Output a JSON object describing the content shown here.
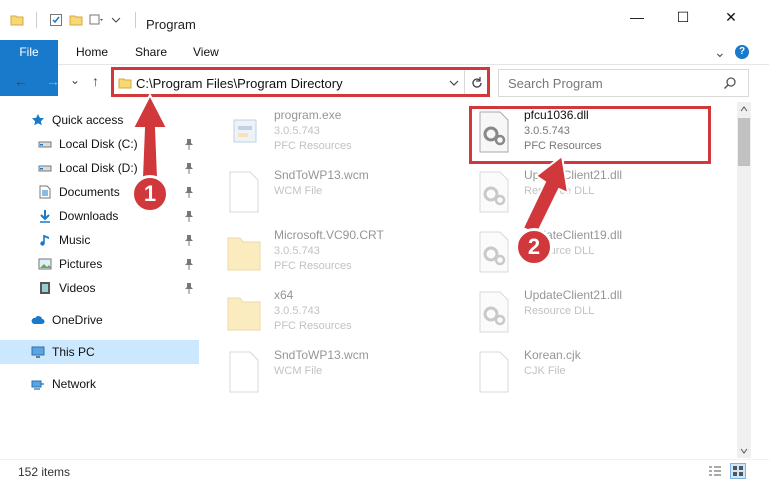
{
  "window": {
    "title": "Program",
    "controls": {
      "minimize": "—",
      "maximize": "☐",
      "close": "✕"
    }
  },
  "ribbon": {
    "tabs": [
      "File",
      "Home",
      "Share",
      "View"
    ],
    "expand_glyph": "⌄",
    "help_glyph": "?"
  },
  "nav": {
    "back": "←",
    "forward": "→",
    "dropdown": "⌄",
    "up": "↑",
    "address": "C:\\Program Files\\Program Directory",
    "search_placeholder": "Search Program"
  },
  "sidebar": {
    "items": [
      {
        "label": "Quick access",
        "icon": "star-icon",
        "pinned": false
      },
      {
        "label": "Local Disk (C:)",
        "icon": "drive-icon",
        "pinned": true
      },
      {
        "label": "Local Disk (D:)",
        "icon": "drive-icon",
        "pinned": true
      },
      {
        "label": "Documents",
        "icon": "documents-icon",
        "pinned": true
      },
      {
        "label": "Downloads",
        "icon": "download-icon",
        "pinned": true
      },
      {
        "label": "Music",
        "icon": "music-icon",
        "pinned": true
      },
      {
        "label": "Pictures",
        "icon": "pictures-icon",
        "pinned": true
      },
      {
        "label": "Videos",
        "icon": "videos-icon",
        "pinned": true
      },
      {
        "label": "OneDrive",
        "icon": "cloud-icon",
        "pinned": false
      },
      {
        "label": "This PC",
        "icon": "computer-icon",
        "pinned": false,
        "selected": true
      },
      {
        "label": "Network",
        "icon": "network-icon",
        "pinned": false
      }
    ]
  },
  "files": [
    {
      "name": "program.exe",
      "line2": "3.0.5.743",
      "line3": "PFC Resources",
      "icon": "exe-icon",
      "faded": true
    },
    {
      "name": "pfcu1036.dll",
      "line2": "3.0.5.743",
      "line3": "PFC Resources",
      "icon": "dll-gear-icon",
      "faded": false
    },
    {
      "name": "SndToWP13.wcm",
      "line2": "WCM File",
      "line3": "",
      "icon": "blank-file-icon",
      "faded": true
    },
    {
      "name": "UpdateClient21.dll",
      "line2": "Resource DLL",
      "line3": "",
      "icon": "dll-gear-icon",
      "faded": true
    },
    {
      "name": "Microsoft.VC90.CRT",
      "line2": "3.0.5.743",
      "line3": "PFC Resources",
      "icon": "folder-icon",
      "faded": true
    },
    {
      "name": "UpdateClient19.dll",
      "line2": "Resource DLL",
      "line3": "",
      "icon": "dll-gear-icon",
      "faded": true
    },
    {
      "name": "x64",
      "line2": "3.0.5.743",
      "line3": "PFC Resources",
      "icon": "folder-icon",
      "faded": true
    },
    {
      "name": "UpdateClient21.dll",
      "line2": "Resource DLL",
      "line3": "",
      "icon": "dll-gear-icon",
      "faded": true
    },
    {
      "name": "SndToWP13.wcm",
      "line2": "WCM File",
      "line3": "",
      "icon": "blank-file-icon",
      "faded": true
    },
    {
      "name": "Korean.cjk",
      "line2": "CJK File",
      "line3": "",
      "icon": "blank-file-icon",
      "faded": true
    }
  ],
  "status": {
    "item_count": "152 items"
  },
  "annotations": [
    {
      "number": "1",
      "color": "#d0383c"
    },
    {
      "number": "2",
      "color": "#d0383c"
    }
  ],
  "colors": {
    "accent": "#1979ca",
    "highlight": "#d0383c",
    "selection": "#cce8ff"
  }
}
